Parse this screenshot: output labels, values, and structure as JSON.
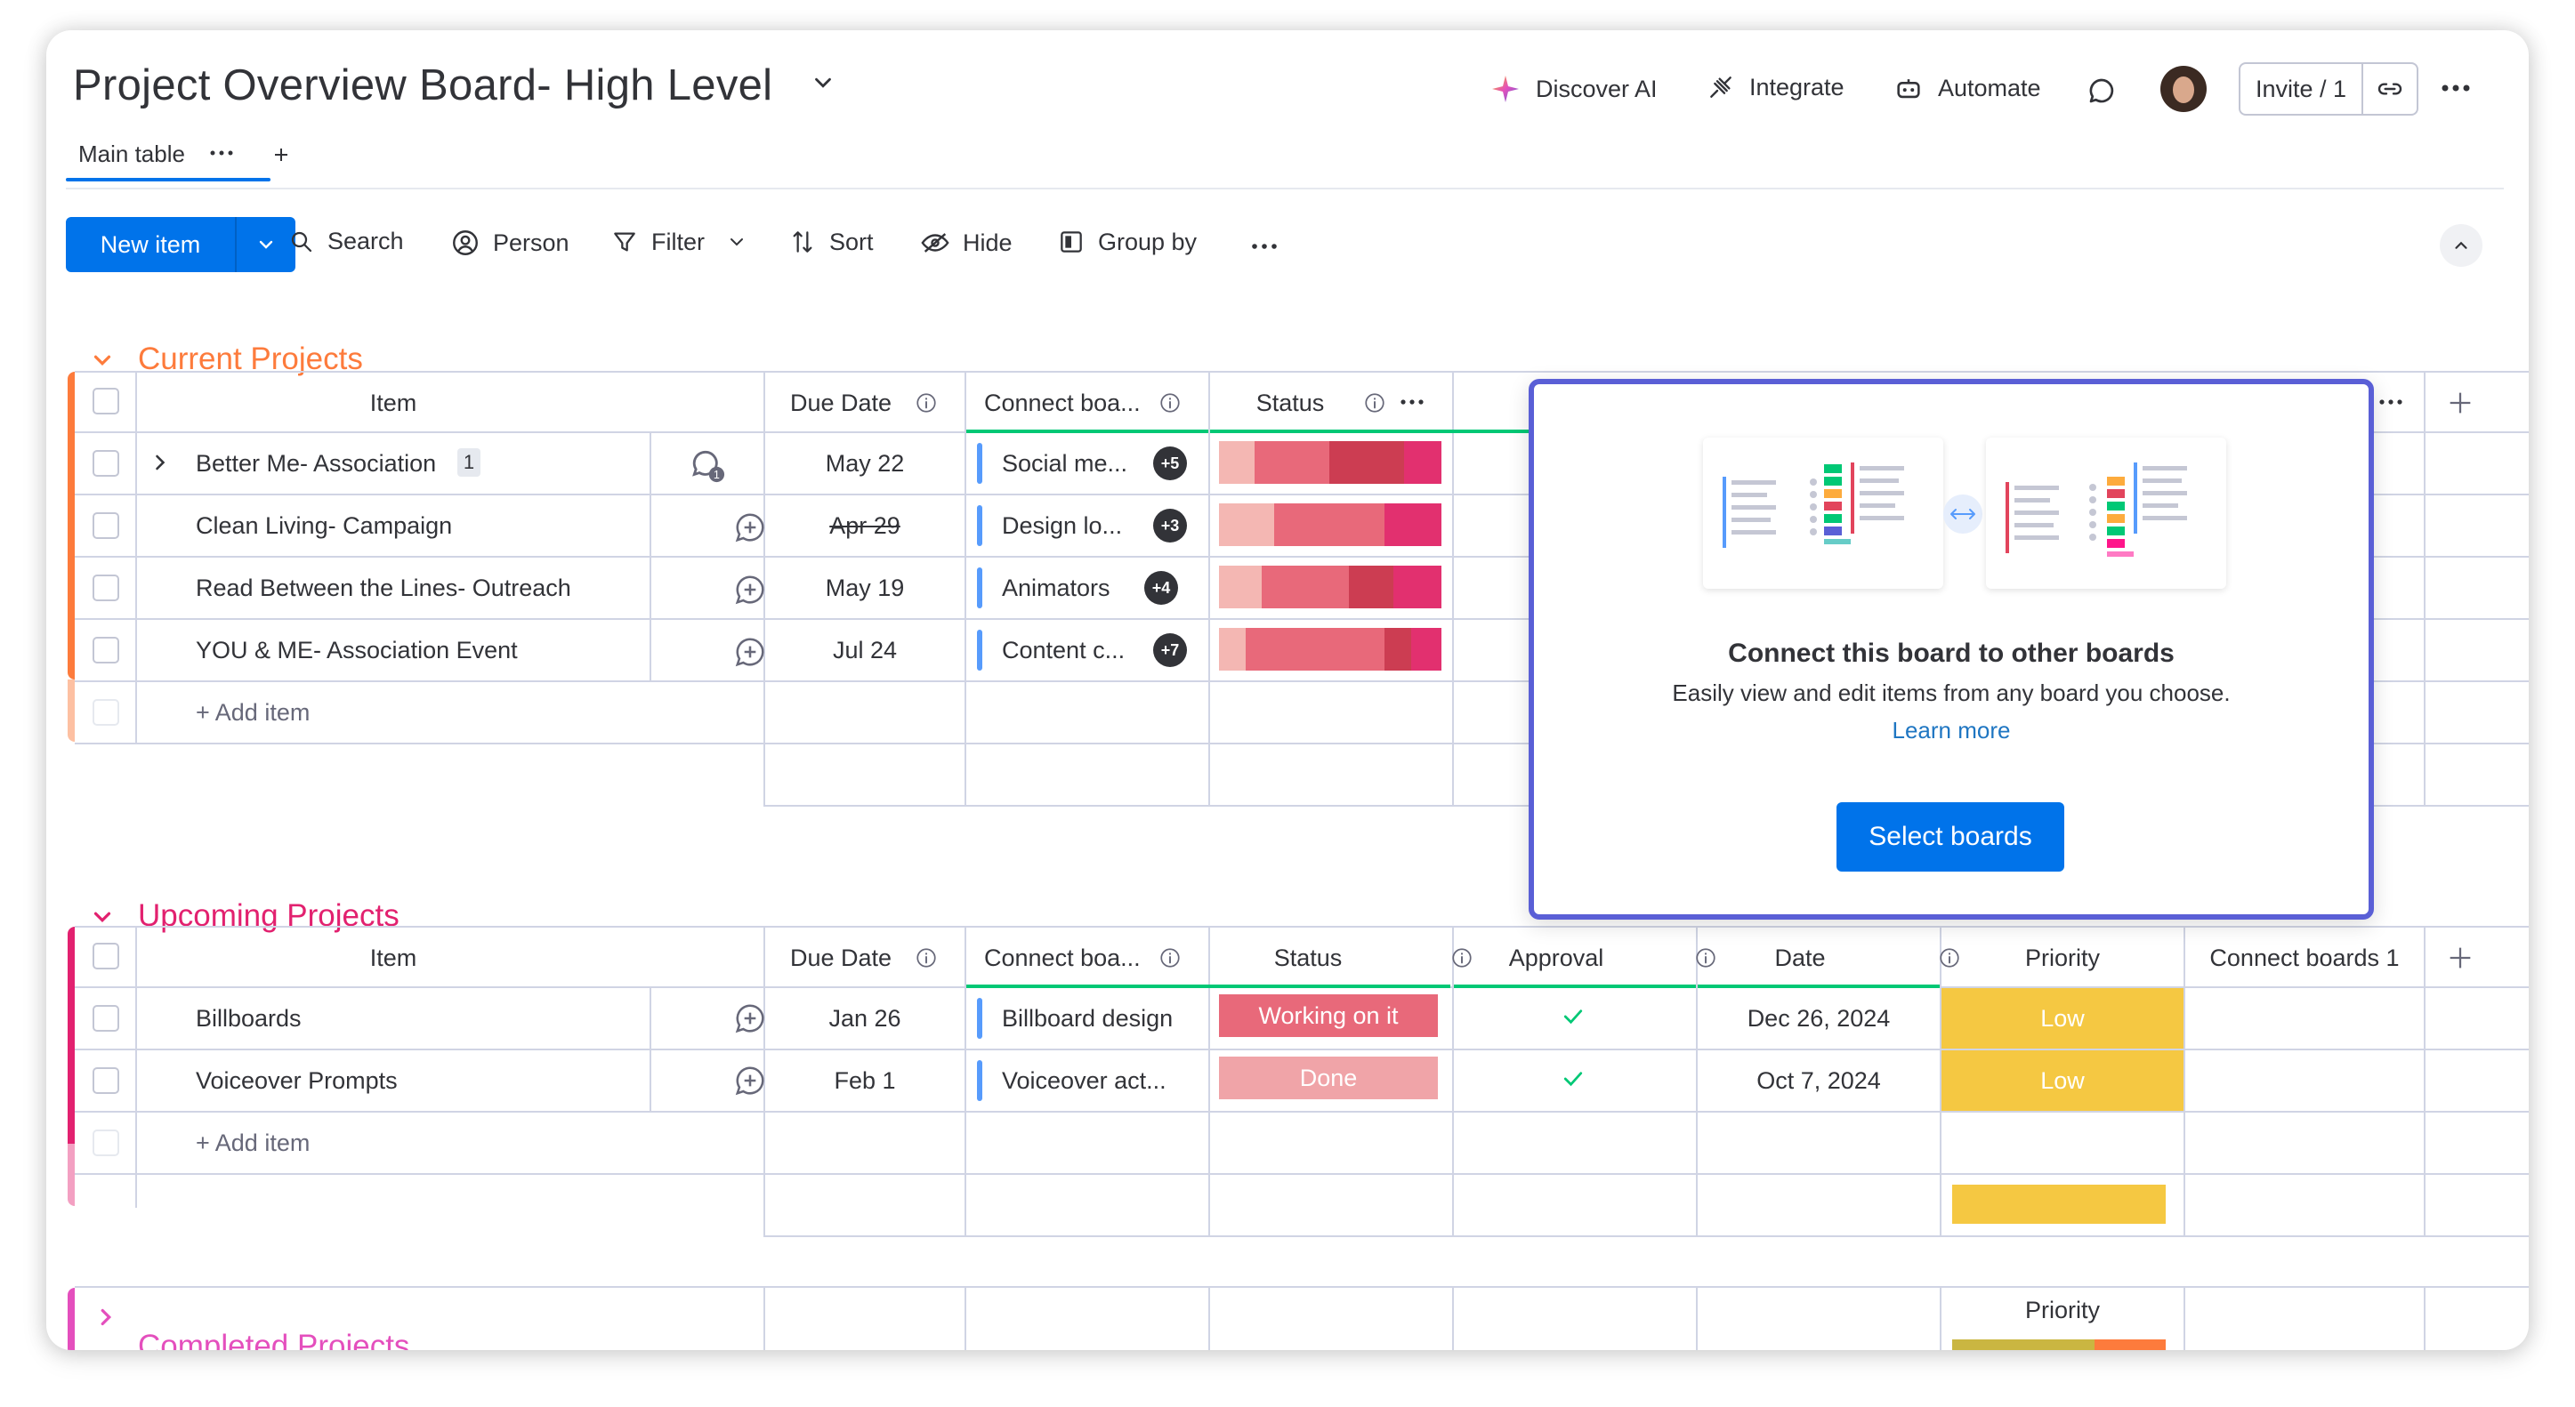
{
  "board": {
    "title": "Project Overview Board- High Level",
    "tabs": [
      {
        "label": "Main table"
      }
    ],
    "header_actions": {
      "discover_ai": "Discover AI",
      "integrate": "Integrate",
      "automate": "Automate",
      "invite": "Invite / 1"
    }
  },
  "toolbar": {
    "new_item": "New item",
    "search": "Search",
    "person": "Person",
    "filter": "Filter",
    "sort": "Sort",
    "hide": "Hide",
    "group_by": "Group by"
  },
  "groups": [
    {
      "name": "Current Projects",
      "color": "#fd7b3c",
      "columns": {
        "item": "Item",
        "due_date": "Due Date",
        "connect": "Connect boa...",
        "status": "Status"
      },
      "rows": [
        {
          "item": "Better Me- Association",
          "subitems": "1",
          "due": "May 22",
          "connect": "Social me...",
          "more": "+5"
        },
        {
          "item": "Clean Living- Campaign",
          "due": "Apr 29",
          "connect": "Design lo...",
          "more": "+3"
        },
        {
          "item": "Read Between the Lines- Outreach",
          "due": "May 19",
          "connect": "Animators",
          "more": "+4"
        },
        {
          "item": "YOU & ME- Association Event",
          "due": "Jul 24",
          "connect": "Content c...",
          "more": "+7"
        }
      ],
      "add_item": "+ Add item"
    },
    {
      "name": "Upcoming Projects",
      "color": "#e2216f",
      "columns": {
        "item": "Item",
        "due_date": "Due Date",
        "connect": "Connect boa...",
        "status": "Status",
        "approval": "Approval",
        "date": "Date",
        "priority": "Priority",
        "connect2": "Connect boards 1"
      },
      "rows": [
        {
          "item": "Billboards",
          "due": "Jan 26",
          "connect": "Billboard design",
          "status": "Working on it",
          "date": "Dec 26, 2024",
          "priority": "Low"
        },
        {
          "item": "Voiceover Prompts",
          "due": "Feb 1",
          "connect": "Voiceover act...",
          "status": "Done",
          "date": "Oct 7, 2024",
          "priority": "Low"
        }
      ],
      "add_item": "+ Add item"
    },
    {
      "name": "Completed Projects",
      "color": "#e44fbd",
      "columns": {
        "priority": "Priority"
      }
    }
  ],
  "popup": {
    "title": "Connect this board to other boards",
    "subtitle": "Easily view and edit items from any board you choose.",
    "link": "Learn more",
    "button": "Select boards"
  },
  "colors": {
    "primary": "#0073ea",
    "current_group": "#fd7b3c",
    "upcoming_group": "#e2216f",
    "completed_group": "#e44fbd",
    "status_working": "#e8697a",
    "status_done": "#f0a4a8",
    "priority_low": "#f5c842",
    "popup_border": "#5a5fd6",
    "approval_check": "#00c875"
  },
  "icons": [
    "chevron-down-icon",
    "ai-sparkle-icon",
    "integrate-icon",
    "automate-icon",
    "chat-icon",
    "avatar",
    "link-icon",
    "more-icon",
    "search-icon",
    "person-icon",
    "filter-icon",
    "sort-icon",
    "hide-icon",
    "group-by-icon",
    "info-icon",
    "plus-icon",
    "add-update-icon",
    "check-icon",
    "expand-icon"
  ]
}
